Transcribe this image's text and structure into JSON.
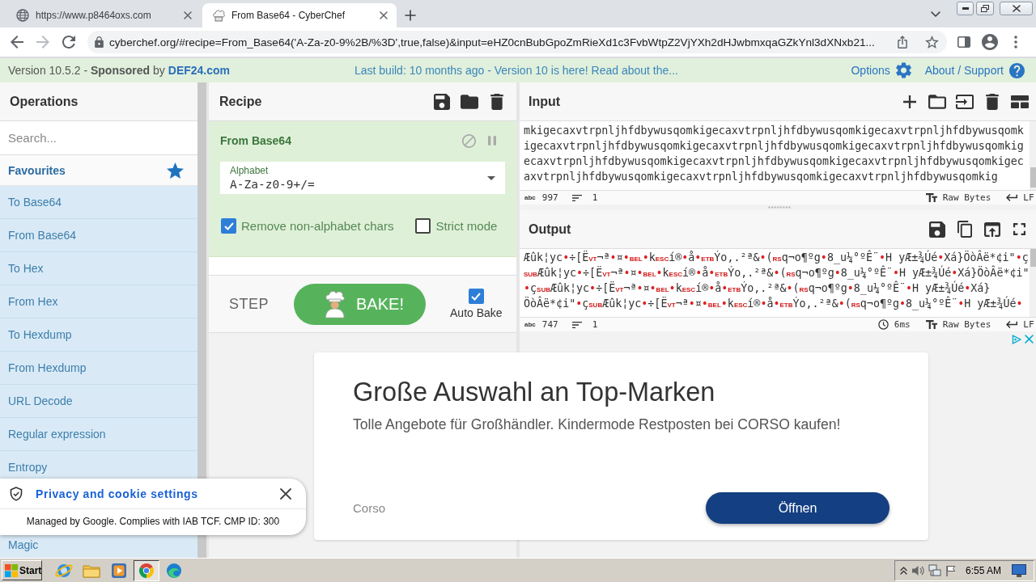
{
  "browser": {
    "tabs": [
      {
        "title": "https://www.p8464oxs.com",
        "selected": false
      },
      {
        "title": "From Base64 - CyberChef",
        "selected": true
      }
    ],
    "url": "cyberchef.org/#recipe=From_Base64('A-Za-z0-9%2B/%3D',true,false)&input=eHZ0cnBubGpoZmRieXd1c3FvbWtpZ2VjYXh2dHJwbmxqaGZkYnl3dXNxb21..."
  },
  "banner": {
    "version": "Version 10.5.2 - **Sponsored** by",
    "sponsor": "DEF24.com",
    "notice": "Last build: 10 months ago - Version 10 is here! Read about the...",
    "options": "Options",
    "about": "About / Support"
  },
  "operations": {
    "title": "Operations",
    "search": {
      "placeholder": "Search..."
    },
    "favourites": "Favourites",
    "items": [
      "To Base64",
      "From Base64",
      "To Hex",
      "From Hex",
      "To Hexdump",
      "From Hexdump",
      "URL Decode",
      "Regular expression",
      "Entropy",
      "Magic"
    ]
  },
  "recipe": {
    "title": "Recipe",
    "operation": {
      "title": "From Base64",
      "alphabet": {
        "label": "Alphabet",
        "value": "A-Za-z0-9+/="
      },
      "options": [
        {
          "label": "Remove non-alphabet chars",
          "checked": true
        },
        {
          "label": "Strict mode",
          "checked": false
        }
      ]
    },
    "step": "STEP",
    "bake": "BAKE!",
    "auto_bake": {
      "label": "Auto Bake",
      "checked": true
    }
  },
  "input": {
    "title": "Input",
    "lines": [
      "mkigecaxvtrpnljhfdbywusqomkigecaxvtrpnljhfdbywusqomkigecaxvtrpnljhfdbywusqomk",
      "igecaxvtrpnljhfdbywusqomkigecaxvtrpnljhfdbywusqomkigecaxvtrpnljhfdbywusqomkig",
      "ecaxvtrpnljhfdbywusqomkigecaxvtrpnljhfdbywusqomkigecaxvtrpnljhfdbywusqomkigec",
      "axvtrpnljhfdbywusqomkigecaxvtrpnljhfdbywusqomkigecaxvtrpnljhfdbywusqomkig"
    ],
    "status": {
      "chars_label": "abc",
      "chars": "997",
      "lines": "1",
      "format": "Raw Bytes",
      "eol": "LF"
    }
  },
  "output": {
    "title": "Output",
    "lines": [
      [
        {
          "kind": "text",
          "text": "Æûk¦yc"
        },
        {
          "kind": "dot",
          "text": "•"
        },
        {
          "kind": "text",
          "text": "÷[Ë"
        },
        {
          "kind": "control",
          "text": "VT"
        },
        {
          "kind": "text",
          "text": "¬ª"
        },
        {
          "kind": "dot",
          "text": "•"
        },
        {
          "kind": "text",
          "text": "¤"
        },
        {
          "kind": "dot",
          "text": "•"
        },
        {
          "kind": "control",
          "text": "BEL"
        },
        {
          "kind": "dot",
          "text": "•"
        },
        {
          "kind": "text",
          "text": "k"
        },
        {
          "kind": "control",
          "text": "ESC"
        },
        {
          "kind": "text",
          "text": "í®"
        },
        {
          "kind": "dot",
          "text": "•"
        },
        {
          "kind": "text",
          "text": "å"
        },
        {
          "kind": "dot",
          "text": "•"
        },
        {
          "kind": "control",
          "text": "ETB"
        },
        {
          "kind": "text",
          "text": "Ýo,.²ª&"
        },
        {
          "kind": "dot",
          "text": "•"
        },
        {
          "kind": "text",
          "text": "("
        },
        {
          "kind": "control",
          "text": "RS"
        },
        {
          "kind": "text",
          "text": "q¬o¶ºg"
        },
        {
          "kind": "dot",
          "text": "•"
        },
        {
          "kind": "text",
          "text": "8_u¼°ºÊ¨"
        },
        {
          "kind": "dot",
          "text": "•"
        },
        {
          "kind": "text",
          "text": "H yÆ±¾Úé"
        },
        {
          "kind": "dot",
          "text": "•"
        },
        {
          "kind": "text",
          "text": "Xá}ÖòÂë*¢i\""
        },
        {
          "kind": "dot",
          "text": "•"
        },
        {
          "kind": "text",
          "text": "ç"
        }
      ],
      [
        {
          "kind": "control",
          "text": "SUB"
        },
        {
          "kind": "text",
          "text": "Æûk¦yc"
        },
        {
          "kind": "dot",
          "text": "•"
        },
        {
          "kind": "text",
          "text": "÷[Ë"
        },
        {
          "kind": "control",
          "text": "VT"
        },
        {
          "kind": "text",
          "text": "¬ª"
        },
        {
          "kind": "dot",
          "text": "•"
        },
        {
          "kind": "text",
          "text": "¤"
        },
        {
          "kind": "dot",
          "text": "•"
        },
        {
          "kind": "control",
          "text": "BEL"
        },
        {
          "kind": "dot",
          "text": "•"
        },
        {
          "kind": "text",
          "text": "k"
        },
        {
          "kind": "control",
          "text": "ESC"
        },
        {
          "kind": "text",
          "text": "í®"
        },
        {
          "kind": "dot",
          "text": "•"
        },
        {
          "kind": "text",
          "text": "å"
        },
        {
          "kind": "dot",
          "text": "•"
        },
        {
          "kind": "control",
          "text": "ETB"
        },
        {
          "kind": "text",
          "text": "Ýo,.²ª&"
        },
        {
          "kind": "dot",
          "text": "•"
        },
        {
          "kind": "text",
          "text": "("
        },
        {
          "kind": "control",
          "text": "RS"
        },
        {
          "kind": "text",
          "text": "q¬o¶ºg"
        },
        {
          "kind": "dot",
          "text": "•"
        },
        {
          "kind": "text",
          "text": "8_u¼°ºÊ¨"
        },
        {
          "kind": "dot",
          "text": "•"
        },
        {
          "kind": "text",
          "text": "H yÆ±¾Úé"
        },
        {
          "kind": "dot",
          "text": "•"
        },
        {
          "kind": "text",
          "text": "Xá}ÖòÂë*¢i\""
        }
      ],
      [
        {
          "kind": "dot",
          "text": "•"
        },
        {
          "kind": "text",
          "text": "ç"
        },
        {
          "kind": "control",
          "text": "SUB"
        },
        {
          "kind": "text",
          "text": "Æûk¦yc"
        },
        {
          "kind": "dot",
          "text": "•"
        },
        {
          "kind": "text",
          "text": "÷[Ë"
        },
        {
          "kind": "control",
          "text": "VT"
        },
        {
          "kind": "text",
          "text": "¬ª"
        },
        {
          "kind": "dot",
          "text": "•"
        },
        {
          "kind": "text",
          "text": "¤"
        },
        {
          "kind": "dot",
          "text": "•"
        },
        {
          "kind": "control",
          "text": "BEL"
        },
        {
          "kind": "dot",
          "text": "•"
        },
        {
          "kind": "text",
          "text": "k"
        },
        {
          "kind": "control",
          "text": "ESC"
        },
        {
          "kind": "text",
          "text": "í®"
        },
        {
          "kind": "dot",
          "text": "•"
        },
        {
          "kind": "text",
          "text": "å"
        },
        {
          "kind": "dot",
          "text": "•"
        },
        {
          "kind": "control",
          "text": "ETB"
        },
        {
          "kind": "text",
          "text": "Ýo,.²ª&"
        },
        {
          "kind": "dot",
          "text": "•"
        },
        {
          "kind": "text",
          "text": "("
        },
        {
          "kind": "control",
          "text": "RS"
        },
        {
          "kind": "text",
          "text": "q¬o¶ºg"
        },
        {
          "kind": "dot",
          "text": "•"
        },
        {
          "kind": "text",
          "text": "8_u¼°ºÊ¨"
        },
        {
          "kind": "dot",
          "text": "•"
        },
        {
          "kind": "text",
          "text": "H yÆ±¾Úé"
        },
        {
          "kind": "dot",
          "text": "•"
        },
        {
          "kind": "text",
          "text": "Xá}"
        }
      ],
      [
        {
          "kind": "text",
          "text": "ÖòÂë*¢i\""
        },
        {
          "kind": "dot",
          "text": "•"
        },
        {
          "kind": "text",
          "text": "ç"
        },
        {
          "kind": "control",
          "text": "SUB"
        },
        {
          "kind": "text",
          "text": "Æûk¦yc"
        },
        {
          "kind": "dot",
          "text": "•"
        },
        {
          "kind": "text",
          "text": "÷[Ë"
        },
        {
          "kind": "control",
          "text": "VT"
        },
        {
          "kind": "text",
          "text": "¬ª"
        },
        {
          "kind": "dot",
          "text": "•"
        },
        {
          "kind": "text",
          "text": "¤"
        },
        {
          "kind": "dot",
          "text": "•"
        },
        {
          "kind": "control",
          "text": "BEL"
        },
        {
          "kind": "dot",
          "text": "•"
        },
        {
          "kind": "text",
          "text": "k"
        },
        {
          "kind": "control",
          "text": "ESC"
        },
        {
          "kind": "text",
          "text": "í®"
        },
        {
          "kind": "dot",
          "text": "•"
        },
        {
          "kind": "text",
          "text": "å"
        },
        {
          "kind": "dot",
          "text": "•"
        },
        {
          "kind": "control",
          "text": "ETB"
        },
        {
          "kind": "text",
          "text": "Ýo,.²ª&"
        },
        {
          "kind": "dot",
          "text": "•"
        },
        {
          "kind": "text",
          "text": "("
        },
        {
          "kind": "control",
          "text": "RS"
        },
        {
          "kind": "text",
          "text": "q¬o¶ºg"
        },
        {
          "kind": "dot",
          "text": "•"
        },
        {
          "kind": "text",
          "text": "8_u¼°ºÊ¨"
        },
        {
          "kind": "dot",
          "text": "•"
        },
        {
          "kind": "text",
          "text": "H yÆ±¾Úé"
        },
        {
          "kind": "dot",
          "text": "•"
        }
      ]
    ],
    "status": {
      "chars_label": "abc",
      "chars": "747",
      "lines": "1",
      "time": "6ms",
      "format": "Raw Bytes",
      "eol": "LF"
    }
  },
  "ad": {
    "title": "Große Auswahl an Top-Marken",
    "text": "Tolle Angebote für Großhändler. Kindermode Restposten bei CORSO kaufen!",
    "advertiser": "Corso",
    "button": "Öffnen"
  },
  "privacy": {
    "title": "Privacy and cookie settings",
    "text": "Managed by Google. Complies with IAB TCF. CMP ID: 300"
  },
  "taskbar": {
    "start": "Start",
    "apps": [
      {
        "selected": false
      },
      {
        "selected": false
      },
      {
        "selected": false
      },
      {
        "selected": true
      },
      {
        "selected": false
      }
    ],
    "time": "6:55 AM"
  }
}
